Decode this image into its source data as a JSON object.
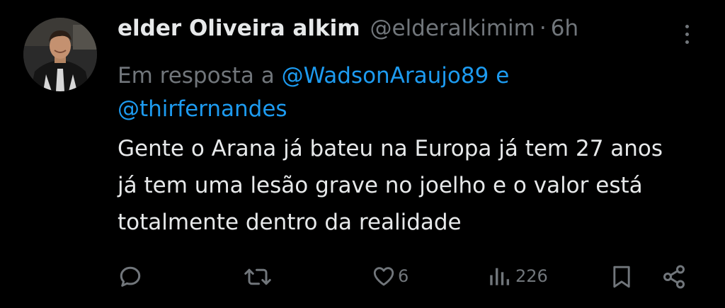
{
  "tweet": {
    "author_name": "elder Oliveira alkim",
    "handle": "@elderalkimim",
    "separator": "·",
    "time": "6h",
    "reply_prefix": "Em resposta a",
    "reply_mention_1": "@WadsonAraujo89",
    "reply_conjunction": "e",
    "reply_mention_2": "@thirfernandes",
    "text": "Gente o Arana já bateu na Europa já tem 27 anos já tem uma lesão grave no joelho e o valor está totalmente dentro da realidade"
  },
  "actions": {
    "reply_icon": "reply-icon",
    "retweet_icon": "retweet-icon",
    "like_icon": "heart-icon",
    "like_count": "6",
    "views_icon": "views-icon",
    "views_count": "226",
    "bookmark_icon": "bookmark-icon",
    "share_icon": "share-icon"
  },
  "colors": {
    "background": "#000000",
    "text": "#e7e9ea",
    "muted": "#71767b",
    "link": "#1d9bf0"
  }
}
